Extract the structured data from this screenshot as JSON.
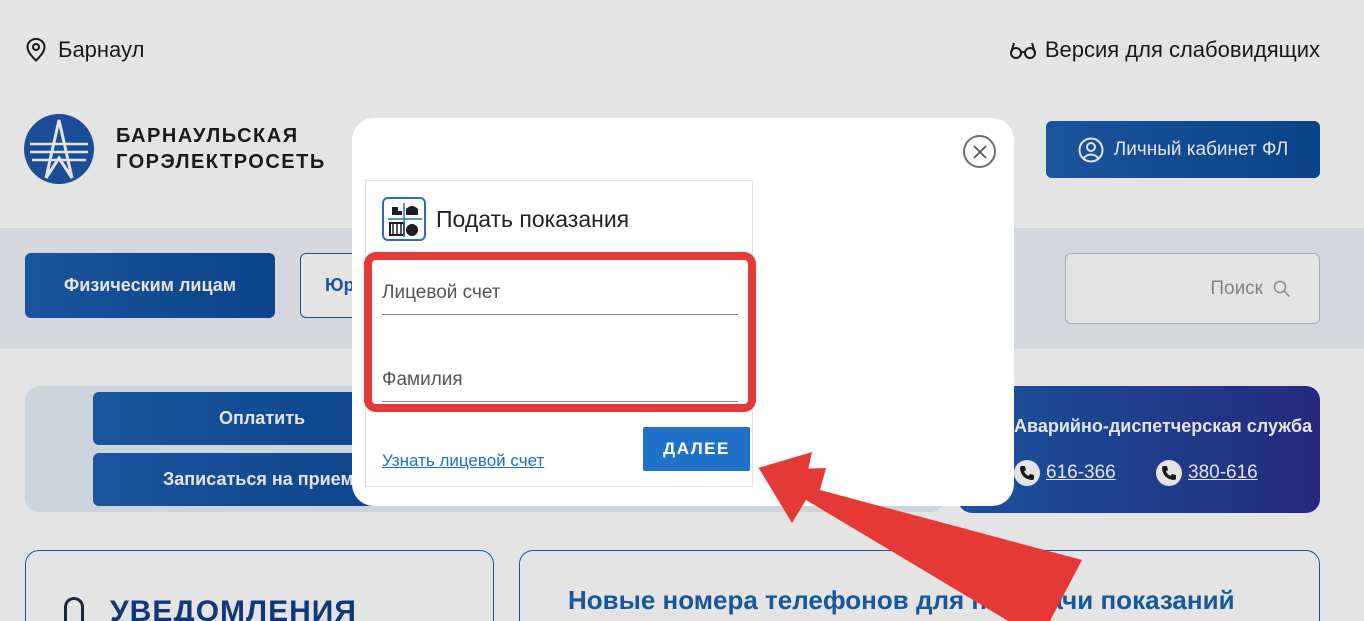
{
  "header": {
    "city": "Барнаул",
    "accessibility_label": "Версия для слабовидящих",
    "logo_line1": "БАРНАУЛЬСКАЯ",
    "logo_line2": "ГОРЭЛЕКТРОСЕТЬ",
    "cabinet_label": "Личный кабинет ФЛ"
  },
  "nav": {
    "tab_individuals": "Физическим лицам",
    "tab_legal_peek": "Юр",
    "search_placeholder": "Поиск"
  },
  "quick_actions": {
    "pay_label": "Оплатить",
    "appointment_label": "Записаться на прием"
  },
  "dispatch": {
    "title": "Аварийно-диспетчерская служба",
    "phone1": "616-366",
    "phone2": "380-616"
  },
  "sections": {
    "notifications_title": "УВЕДОМЛЕНИЯ",
    "news_title": "Новые номера телефонов для передачи показаний"
  },
  "modal": {
    "title": "Подать показания",
    "account_placeholder": "Лицевой счет",
    "surname_placeholder": "Фамилия",
    "find_account_link": "Узнать лицевой счет",
    "next_button": "ДАЛЕЕ"
  },
  "colors": {
    "brand_blue": "#1e5fb0",
    "annotation_red": "#e53935",
    "button_blue": "#1f72c8"
  }
}
